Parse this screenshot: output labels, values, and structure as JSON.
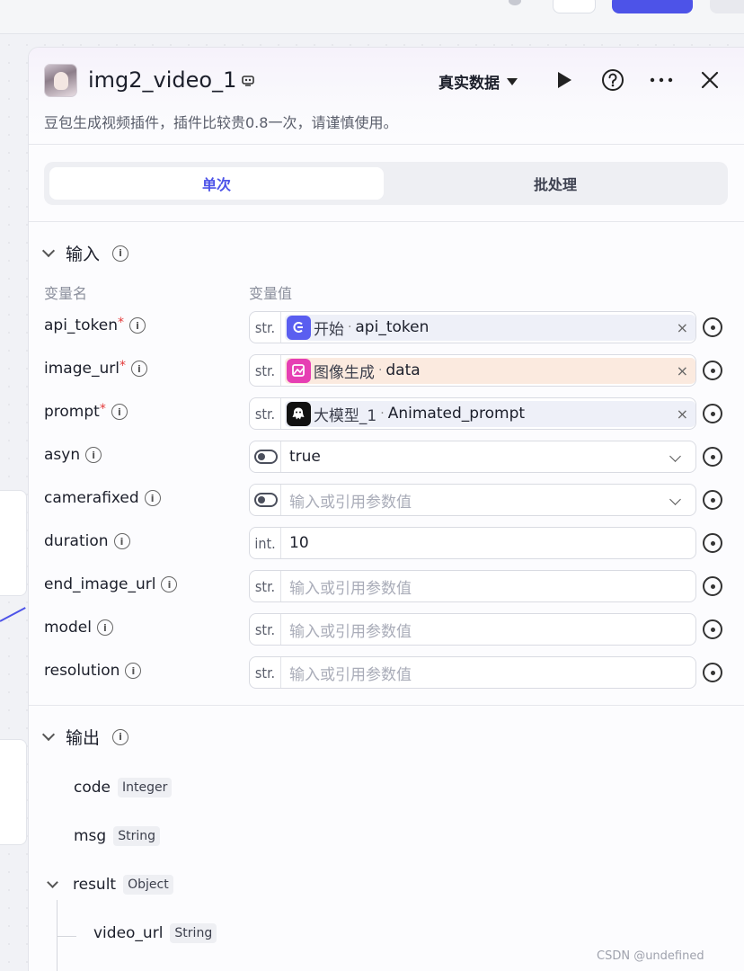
{
  "header": {
    "title": "img2_video_1",
    "data_mode": "真实数据",
    "description": "豆包生成视频插件，插件比较贵0.8一次，请谨慎使用。"
  },
  "tabs": [
    {
      "label": "单次",
      "active": true
    },
    {
      "label": "批处理",
      "active": false
    }
  ],
  "inputs": {
    "title": "输入",
    "col_name": "变量名",
    "col_value": "变量值",
    "rows": [
      {
        "name": "api_token",
        "required": true,
        "type": "str.",
        "ref": {
          "source": "开始",
          "key": "api_token",
          "icon": "start-icon"
        }
      },
      {
        "name": "image_url",
        "required": true,
        "type": "str.",
        "ref": {
          "source": "图像生成",
          "key": "data",
          "icon": "image-generate-icon"
        }
      },
      {
        "name": "prompt",
        "required": true,
        "type": "str.",
        "ref": {
          "source": "大模型_1",
          "key": "Animated_prompt",
          "icon": "llm-icon"
        }
      },
      {
        "name": "asyn",
        "required": false,
        "type": "toggle",
        "value": "true"
      },
      {
        "name": "camerafixed",
        "required": false,
        "type": "toggle",
        "placeholder": "输入或引用参数值"
      },
      {
        "name": "duration",
        "required": false,
        "type": "int.",
        "value": "10"
      },
      {
        "name": "end_image_url",
        "required": false,
        "type": "str.",
        "placeholder": "输入或引用参数值"
      },
      {
        "name": "model",
        "required": false,
        "type": "str.",
        "placeholder": "输入或引用参数值"
      },
      {
        "name": "resolution",
        "required": false,
        "type": "str.",
        "placeholder": "输入或引用参数值"
      }
    ]
  },
  "outputs": {
    "title": "输出",
    "items": [
      {
        "name": "code",
        "type": "Integer"
      },
      {
        "name": "msg",
        "type": "String"
      },
      {
        "name": "result",
        "type": "Object"
      },
      {
        "name": "video_url",
        "type": "String"
      }
    ]
  },
  "watermark": "CSDN @undefined",
  "colors": {
    "accent": "#4d53e8",
    "required": "#e33a3a"
  }
}
